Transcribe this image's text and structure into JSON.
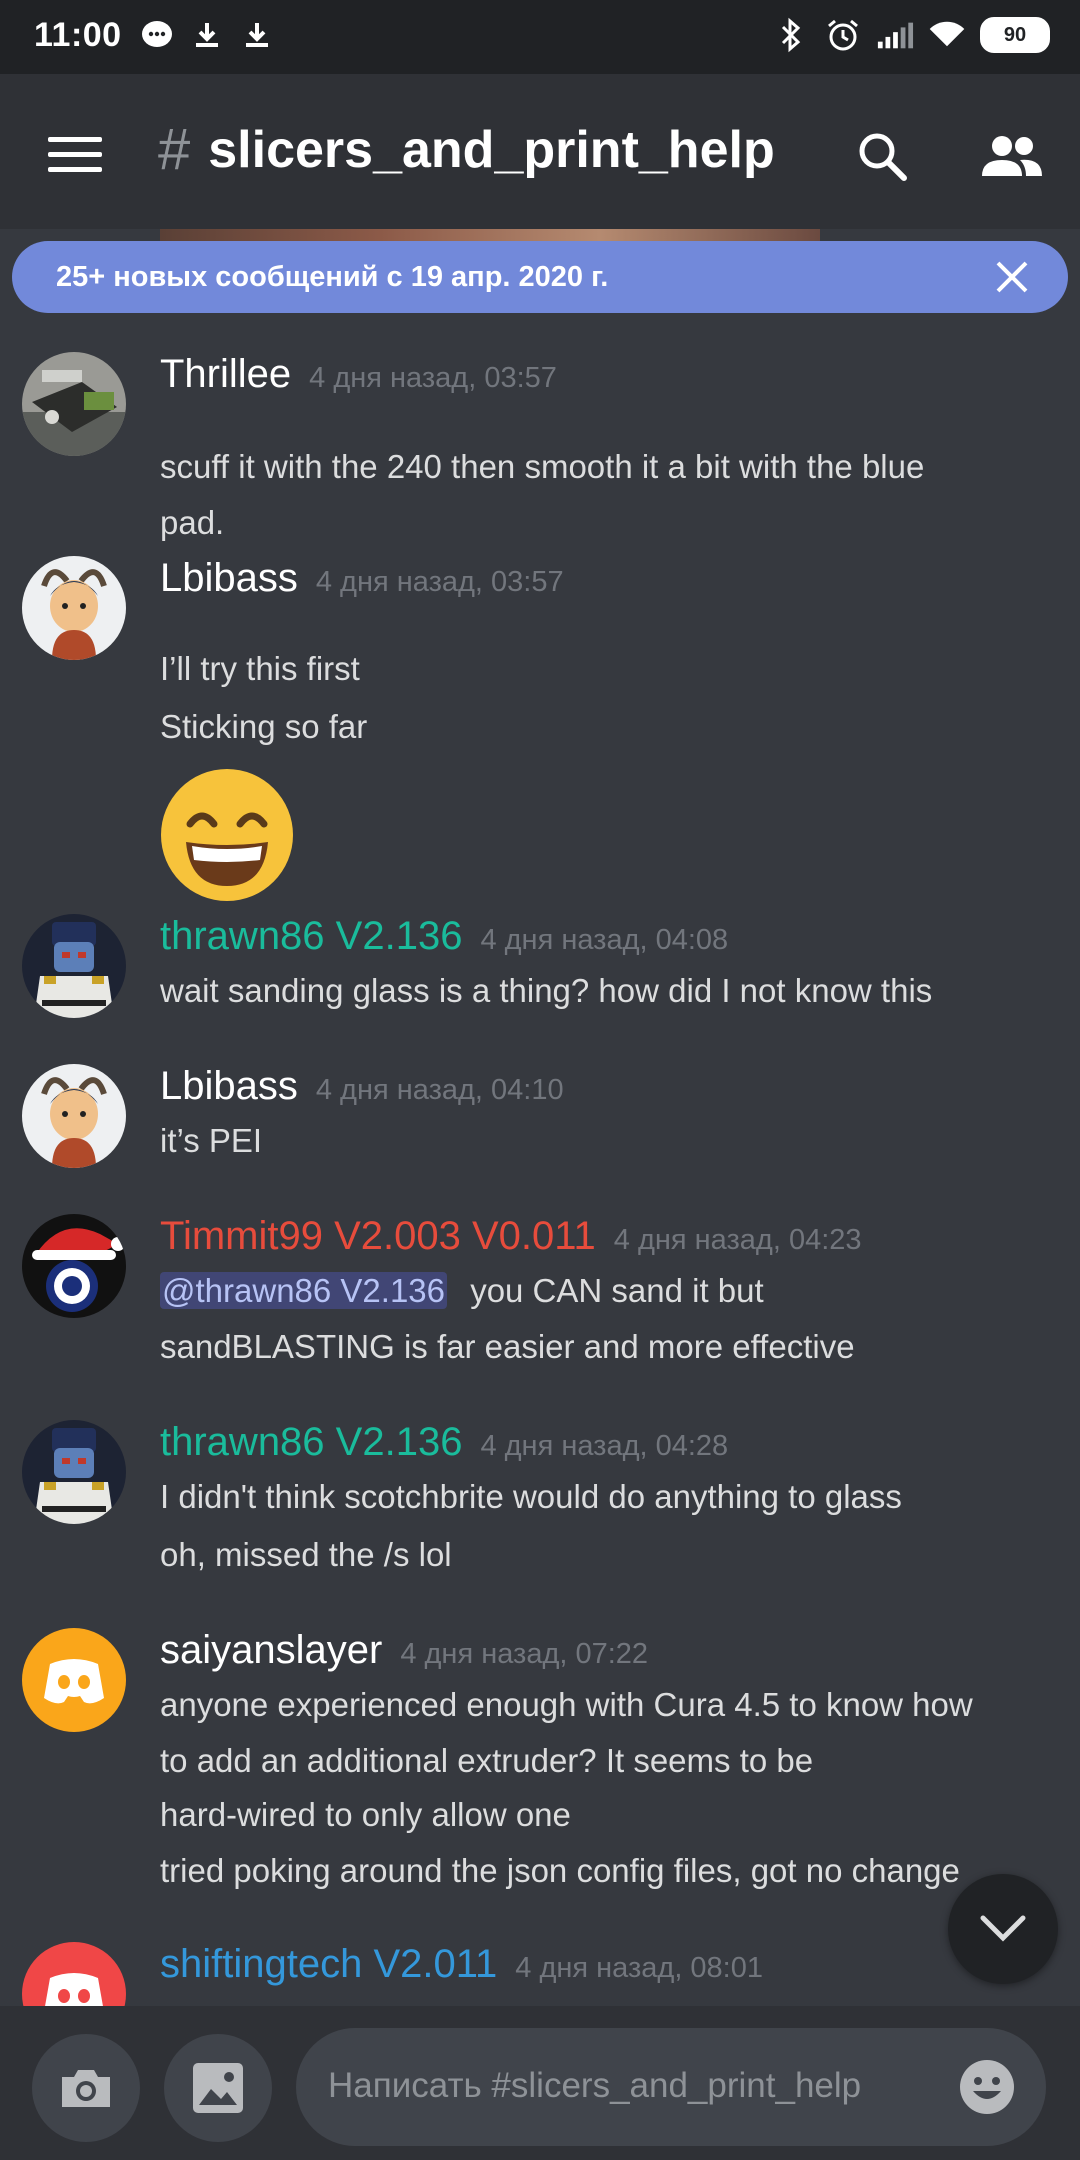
{
  "status_bar": {
    "time": "11:00",
    "battery": "90",
    "left_icons": [
      "messenger-icon",
      "download-icon",
      "download-icon"
    ],
    "right_icons": [
      "bluetooth-icon",
      "alarm-icon",
      "signal-icon",
      "wifi-icon",
      "battery-icon"
    ]
  },
  "header": {
    "channel_hash": "#",
    "channel_name": "slicers_and_print_help",
    "icons": [
      "menu-icon",
      "search-icon",
      "members-icon"
    ]
  },
  "banner": {
    "text": "25+ новых сообщений с 19 апр. 2020 г.",
    "close_icon": "close-icon"
  },
  "messages": [
    {
      "username": "Thrillee",
      "username_color": "#ffffff",
      "timestamp": "4 дня назад, 03:57",
      "lines": [
        "scuff it with the 240 then smooth it a bit with the blue",
        "pad."
      ]
    },
    {
      "username": "Lbibass",
      "username_color": "#ffffff",
      "timestamp": "4 дня назад, 03:57",
      "lines": [
        "I’ll try this first",
        "Sticking so far"
      ],
      "emoji": "grinning-face-emoji"
    },
    {
      "username": "thrawn86 V2.136",
      "username_color": "#1abc9c",
      "timestamp": "4 дня назад, 04:08",
      "lines": [
        "wait sanding glass is a thing?  how did I not know this"
      ]
    },
    {
      "username": "Lbibass",
      "username_color": "#ffffff",
      "timestamp": "4 дня назад, 04:10",
      "lines": [
        "it’s PEI"
      ]
    },
    {
      "username": "Timmit99 V2.003 V0.011",
      "username_color": "#e74c3c",
      "timestamp": "4 дня назад, 04:23",
      "mention": "@thrawn86 V2.136",
      "lines": [
        "you CAN sand it but",
        "sandBLASTING is far easier and more effective"
      ]
    },
    {
      "username": "thrawn86 V2.136",
      "username_color": "#1abc9c",
      "timestamp": "4 дня назад, 04:28",
      "lines": [
        "I didn't think scotchbrite would do anything to glass",
        "oh, missed the /s lol"
      ]
    },
    {
      "username": "saiyanslayer",
      "username_color": "#ffffff",
      "timestamp": "4 дня назад, 07:22",
      "lines": [
        "anyone experienced enough with Cura 4.5 to know how",
        "to add an additional extruder? It seems to be",
        "hard-wired to only allow one",
        "tried poking around the json config files, got no change"
      ]
    },
    {
      "username": "shiftingtech V2.011",
      "username_color": "#3498db",
      "timestamp": "4 дня назад, 08:01",
      "lines": []
    }
  ],
  "composer": {
    "placeholder": "Написать #slicers_and_print_help",
    "icons": [
      "camera-icon",
      "image-icon",
      "emoji-icon"
    ]
  },
  "scroll_button": {
    "icon": "chevron-down-icon"
  }
}
